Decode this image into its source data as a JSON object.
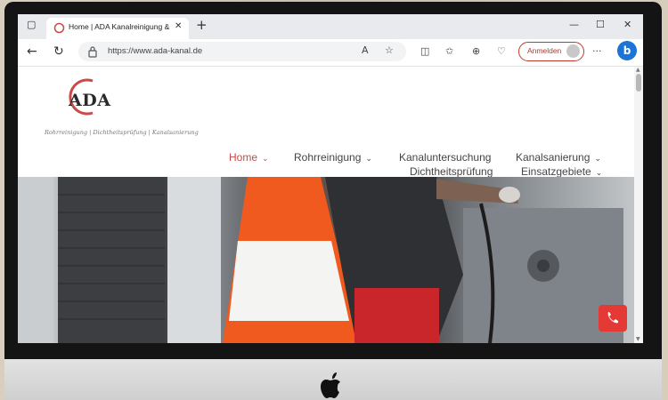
{
  "browser": {
    "tab_title": "Home | ADA Kanalreinigung & Sa",
    "url": "https://www.ada-kanal.de",
    "signin_label": "Anmelden"
  },
  "site": {
    "logo_text": "ADA",
    "tagline": "Rohrreinigung | Dichtheitsprüfung | Kanalsanierung",
    "nav": {
      "home": "Home",
      "rohrreinigung": "Rohrreinigung",
      "kanaluntersuchung": "Kanaluntersuchung",
      "kanalsanierung": "Kanalsanierung",
      "dichtheitspruefung": "Dichtheitsprüfung",
      "einsatzgebiete": "Einsatzgebiete"
    },
    "brand_color": "#c94a47",
    "call_button_color": "#e53935"
  }
}
